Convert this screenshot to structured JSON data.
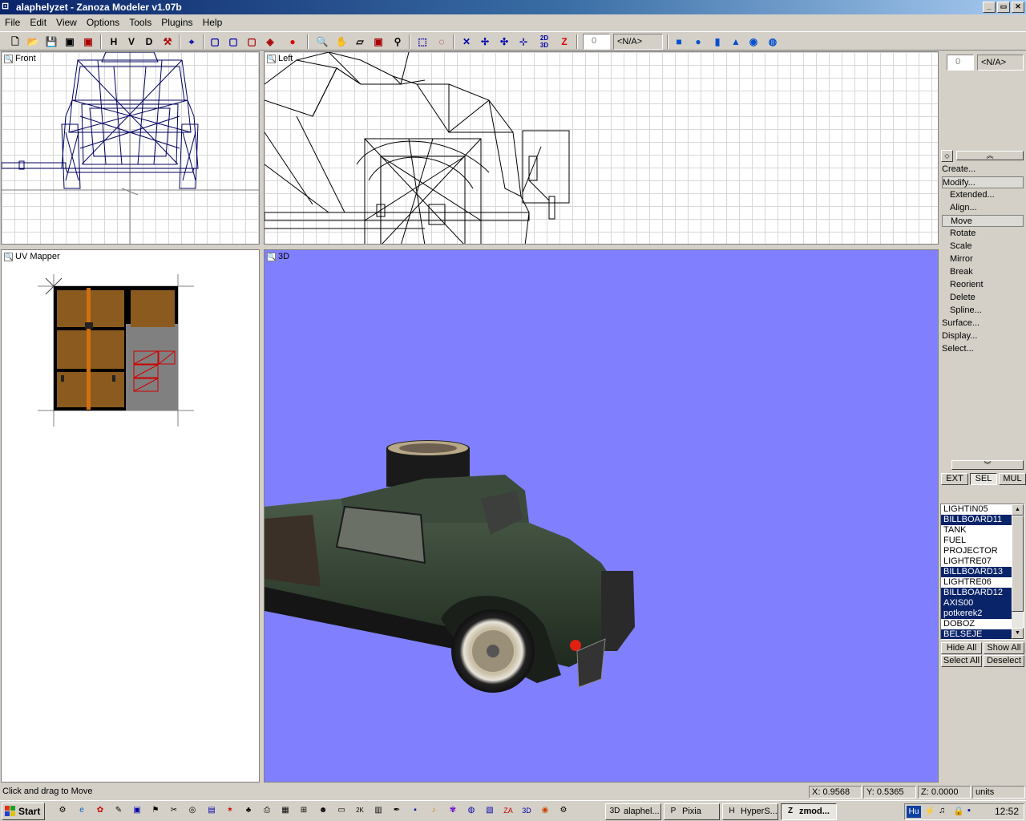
{
  "window": {
    "title": "alaphelyzet - Zanoza Modeler v1.07b",
    "minimize": "_",
    "maximize": "▭",
    "close": "✕"
  },
  "menu": [
    "File",
    "Edit",
    "View",
    "Options",
    "Tools",
    "Plugins",
    "Help"
  ],
  "toolbar": {
    "view_h": "H",
    "view_v": "V",
    "view_d": "D",
    "snap_value": "0",
    "snap_combo": "<N/A>",
    "tool_2d3d": "2D 3D",
    "tool_z": "Z"
  },
  "viewports": {
    "front": "Front",
    "left": "Left",
    "uv": "UV Mapper",
    "persp": "3D"
  },
  "side": {
    "spin_value": "0",
    "combo": "<N/A>",
    "commands": [
      {
        "label": "Create...",
        "level": 0,
        "selected": false
      },
      {
        "label": "Modify...",
        "level": 0,
        "selected": true
      },
      {
        "label": "Extended...",
        "level": 1,
        "selected": false
      },
      {
        "label": "Align...",
        "level": 1,
        "selected": false
      },
      {
        "label": "Move",
        "level": 1,
        "selected": true
      },
      {
        "label": "Rotate",
        "level": 1,
        "selected": false
      },
      {
        "label": "Scale",
        "level": 1,
        "selected": false
      },
      {
        "label": "Mirror",
        "level": 1,
        "selected": false
      },
      {
        "label": "Break",
        "level": 1,
        "selected": false
      },
      {
        "label": "Reorient",
        "level": 1,
        "selected": false
      },
      {
        "label": "Delete",
        "level": 1,
        "selected": false
      },
      {
        "label": "Spline...",
        "level": 1,
        "selected": false
      },
      {
        "label": "Surface...",
        "level": 0,
        "selected": false
      },
      {
        "label": "Display...",
        "level": 0,
        "selected": false
      },
      {
        "label": "Select...",
        "level": 0,
        "selected": false
      }
    ],
    "modes": {
      "ext": "EXT",
      "sel": "SEL",
      "mul": "MUL"
    },
    "objects": [
      {
        "name": "LIGHTIN05",
        "selected": false
      },
      {
        "name": "BILLBOARD11",
        "selected": true
      },
      {
        "name": "TANK",
        "selected": false
      },
      {
        "name": "FUEL",
        "selected": false
      },
      {
        "name": "PROJECTOR",
        "selected": false
      },
      {
        "name": "LIGHTRE07",
        "selected": false
      },
      {
        "name": "BILLBOARD13",
        "selected": true
      },
      {
        "name": "LIGHTRE06",
        "selected": false
      },
      {
        "name": "BILLBOARD12",
        "selected": true
      },
      {
        "name": "AXIS00",
        "selected": true
      },
      {
        "name": "potkerek2",
        "selected": true
      },
      {
        "name": "DOBOZ",
        "selected": false
      },
      {
        "name": "BELSEJE",
        "selected": true
      }
    ],
    "hide_all": "Hide All",
    "show_all": "Show All",
    "select_all": "Select All",
    "deselect": "Deselect"
  },
  "status": {
    "message": "Click and drag to Move",
    "x": "X: 0.9568",
    "y": "Y: 0.5365",
    "z": "Z: 0.0000",
    "units": "units"
  },
  "taskbar": {
    "start": "Start",
    "tasks": [
      {
        "label": "alaphel...",
        "icon": "3D",
        "active": false
      },
      {
        "label": "Pixia",
        "icon": "P",
        "active": false
      },
      {
        "label": "HyperS...",
        "icon": "H",
        "active": false
      },
      {
        "label": "zmod...",
        "icon": "Z",
        "active": true
      }
    ],
    "lang": "Hu",
    "clock": "12:52"
  },
  "colors": {
    "persp_bg": "#8080ff",
    "selection": "#0a246a",
    "wire": "#000060"
  }
}
